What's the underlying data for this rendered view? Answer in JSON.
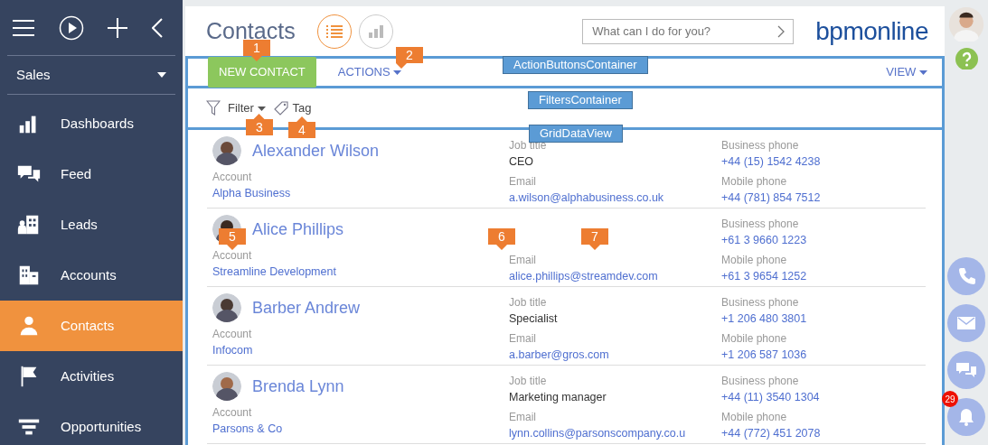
{
  "sidebar": {
    "section": "Sales",
    "items": [
      {
        "label": "Dashboards",
        "selected": false
      },
      {
        "label": "Feed",
        "selected": false
      },
      {
        "label": "Leads",
        "selected": false
      },
      {
        "label": "Accounts",
        "selected": false
      },
      {
        "label": "Contacts",
        "selected": true
      },
      {
        "label": "Activities",
        "selected": false
      },
      {
        "label": "Opportunities",
        "selected": false
      }
    ]
  },
  "header": {
    "title": "Contacts",
    "views": [
      {
        "selected": true
      },
      {
        "selected": false
      }
    ],
    "search": {
      "placeholder": "What can I do for you?"
    },
    "logo": "bpmonline"
  },
  "actions": {
    "primary": "NEW CONTACT",
    "menu": "ACTIONS",
    "view": "VIEW"
  },
  "filters": {
    "filter": "Filter",
    "tag": "Tag"
  },
  "contacts": [
    {
      "name": "Alexander Wilson",
      "job_title": {
        "label": "Job title",
        "value": "CEO"
      },
      "business_phone": {
        "label": "Business phone",
        "value": "+44 (15) 1542 4238"
      },
      "account": {
        "label": "Account",
        "value": "Alpha Business"
      },
      "email": {
        "label": "Email",
        "value": "a.wilson@alphabusiness.co.uk"
      },
      "mobile_phone": {
        "label": "Mobile phone",
        "value": "+44 (781) 854 7512"
      }
    },
    {
      "name": "Alice Phillips",
      "business_phone": {
        "label": "Business phone",
        "value": "+61 3 9660 1223"
      },
      "account": {
        "label": "Account",
        "value": "Streamline Development"
      },
      "email": {
        "label": "Email",
        "value": "alice.phillips@streamdev.com"
      },
      "mobile_phone": {
        "label": "Mobile phone",
        "value": "+61 3 9654 1252"
      }
    },
    {
      "name": "Barber Andrew",
      "job_title": {
        "label": "Job title",
        "value": "Specialist"
      },
      "business_phone": {
        "label": "Business phone",
        "value": "+1 206 480 3801"
      },
      "account": {
        "label": "Account",
        "value": "Infocom"
      },
      "email": {
        "label": "Email",
        "value": "a.barber@gros.com"
      },
      "mobile_phone": {
        "label": "Mobile phone",
        "value": "+1 206 587 1036"
      }
    },
    {
      "name": "Brenda Lynn",
      "job_title": {
        "label": "Job title",
        "value": "Marketing manager"
      },
      "business_phone": {
        "label": "Business phone",
        "value": "+44 (11) 3540 1304"
      },
      "account": {
        "label": "Account",
        "value": "Parsons & Co"
      },
      "email": {
        "label": "Email",
        "value": "lynn.collins@parsonscompany.co.u"
      },
      "mobile_phone": {
        "label": "Mobile phone",
        "value": "+44 (772) 451 2078"
      }
    }
  ],
  "notifications": {
    "badge": "29"
  },
  "annotations": {
    "callouts": [
      {
        "label": "1",
        "kind": "down"
      },
      {
        "label": "2",
        "kind": "down"
      },
      {
        "label": "3",
        "kind": "up"
      },
      {
        "label": "4",
        "kind": "up"
      },
      {
        "label": "5",
        "kind": "down"
      },
      {
        "label": "6",
        "kind": "down"
      },
      {
        "label": "7",
        "kind": "down"
      }
    ],
    "labels": [
      "ActionButtonsContainer",
      "FiltersContainer",
      "GridDataView"
    ]
  }
}
